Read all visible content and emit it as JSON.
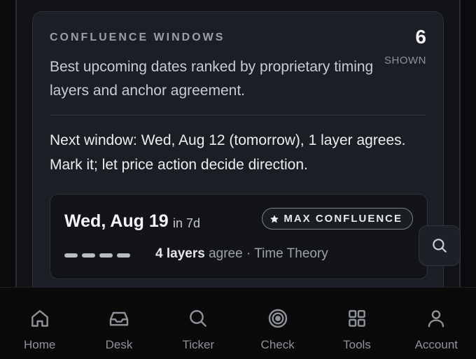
{
  "card": {
    "eyebrow": "CONFLUENCE WINDOWS",
    "count": "6",
    "count_label": "SHOWN",
    "description": "Best upcoming dates ranked by proprietary timing layers and anchor agreement.",
    "next_window": "Next window: Wed, Aug 12 (tomorrow), 1 layer agrees. Mark it; let price action decide direction."
  },
  "window_item": {
    "date": "Wed, Aug 19",
    "relative": "in 7d",
    "badge": "MAX CONFLUENCE",
    "badge_icon": "star-icon",
    "layers_active": 4,
    "layers_strong": "4 layers",
    "layers_agree": " agree · Time Theory"
  },
  "search_fab": {
    "icon": "search-icon"
  },
  "tabbar": {
    "tabs": [
      {
        "label": "Home",
        "icon": "home-icon"
      },
      {
        "label": "Desk",
        "icon": "inbox-icon"
      },
      {
        "label": "Ticker",
        "icon": "search-icon"
      },
      {
        "label": "Check",
        "icon": "target-icon"
      },
      {
        "label": "Tools",
        "icon": "grid-icon"
      },
      {
        "label": "Account",
        "icon": "user-icon"
      }
    ]
  },
  "colors": {
    "background": "#0b0b0d",
    "card": "#1b1e24",
    "muted": "#8e939a",
    "text": "#e8e8ea"
  }
}
